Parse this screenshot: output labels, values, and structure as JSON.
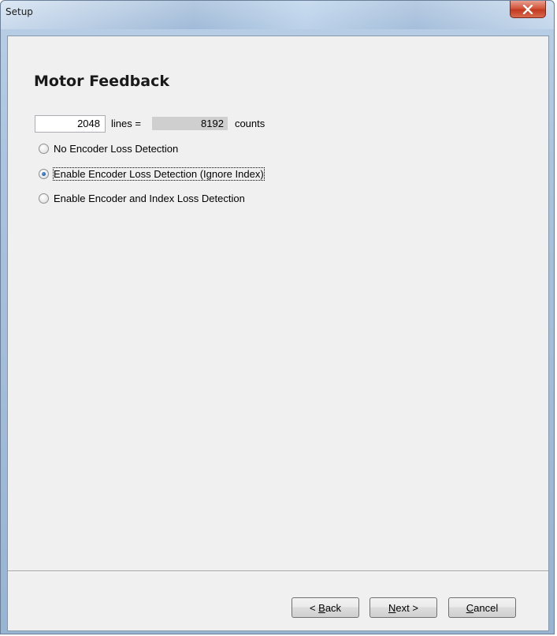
{
  "window": {
    "title": "Setup"
  },
  "page": {
    "title": "Motor Feedback"
  },
  "encoder": {
    "lines_value": "2048",
    "lines_label": "lines =",
    "counts_value": "8192",
    "counts_label": "counts"
  },
  "loss_detection": {
    "options": [
      {
        "label": "No Encoder Loss Detection",
        "selected": false
      },
      {
        "label": "Enable Encoder Loss Detection (Ignore Index)",
        "selected": true
      },
      {
        "label": "Enable Encoder and Index Loss Detection",
        "selected": false
      }
    ]
  },
  "buttons": {
    "back": {
      "prefix": "< ",
      "mnemonic": "B",
      "rest": "ack"
    },
    "next": {
      "prefix": "",
      "mnemonic": "N",
      "rest": "ext >"
    },
    "cancel": {
      "prefix": "",
      "mnemonic": "C",
      "rest": "ancel"
    }
  },
  "colors": {
    "accent_radio": "#1b5fb0",
    "close_button": "#c23a1f",
    "dialog_background": "#f0f0f0"
  }
}
